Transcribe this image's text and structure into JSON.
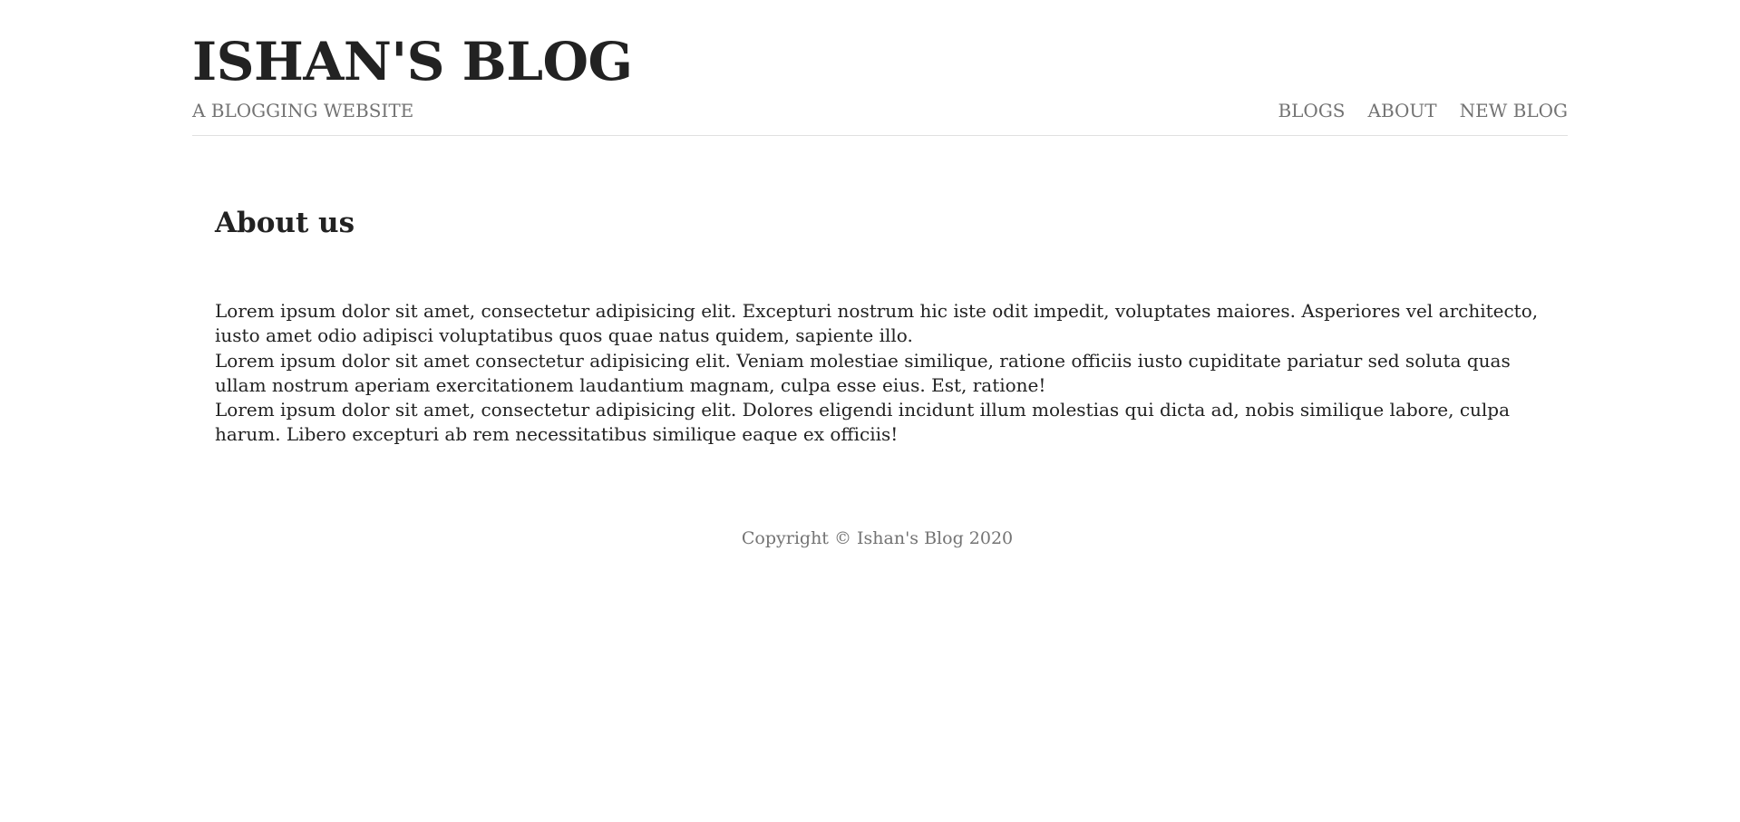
{
  "header": {
    "title": "ISHAN'S BLOG",
    "tagline": "A BLOGGING WEBSITE",
    "nav": [
      {
        "label": "BLOGS"
      },
      {
        "label": "ABOUT"
      },
      {
        "label": "NEW BLOG"
      }
    ]
  },
  "main": {
    "title": "About us",
    "paragraphs": [
      "Lorem ipsum dolor sit amet, consectetur adipisicing elit. Excepturi nostrum hic iste odit impedit, voluptates maiores. Asperiores vel architecto, iusto amet odio adipisci voluptatibus quos quae natus quidem, sapiente illo.",
      "Lorem ipsum dolor sit amet consectetur adipisicing elit. Veniam molestiae similique, ratione officiis iusto cupiditate pariatur sed soluta quas ullam nostrum aperiam exercitationem laudantium magnam, culpa esse eius. Est, ratione!",
      "Lorem ipsum dolor sit amet, consectetur adipisicing elit. Dolores eligendi incidunt illum molestias qui dicta ad, nobis similique labore, culpa harum. Libero excepturi ab rem necessitatibus similique eaque ex officiis!"
    ]
  },
  "footer": {
    "copyright": "Copyright © Ishan's Blog 2020"
  }
}
